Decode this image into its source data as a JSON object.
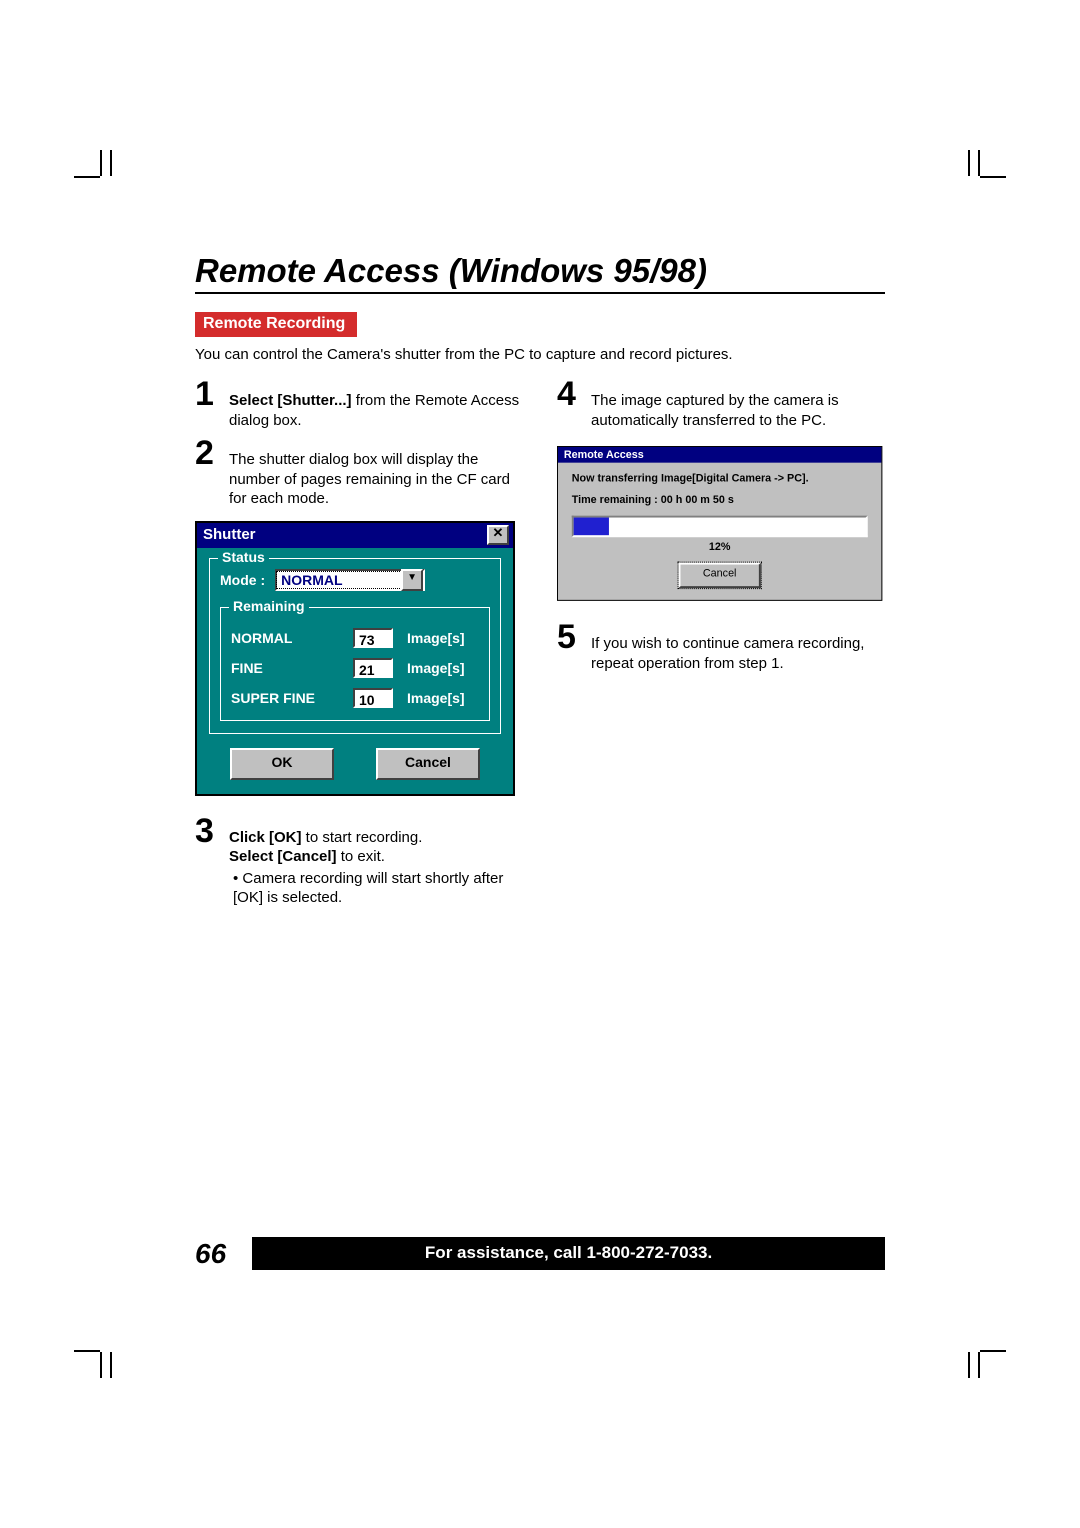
{
  "title": "Remote Access (Windows 95/98)",
  "section": "Remote Recording",
  "intro": "You can control the Camera's shutter from the PC to capture and record pictures.",
  "steps": {
    "s1": {
      "num": "1",
      "bold": "Select [Shutter...]",
      "rest": "  from the Remote Access dialog box."
    },
    "s2": {
      "num": "2",
      "text": "The shutter dialog box will display the number of pages remaining in the CF card for each mode."
    },
    "s3": {
      "num": "3",
      "bold1": "Click [OK]",
      "rest1": " to start recording.",
      "bold2": "Select [Cancel]",
      "rest2": " to exit.",
      "bullet": "• Camera recording will start shortly after [OK] is selected."
    },
    "s4": {
      "num": "4",
      "text": "The image captured by the camera is automatically transferred to the PC."
    },
    "s5": {
      "num": "5",
      "text": "If you wish to continue camera recording, repeat operation from step 1."
    }
  },
  "shutter": {
    "title": "Shutter",
    "status_legend": "Status",
    "mode_label": "Mode :",
    "mode_value": "NORMAL",
    "remaining_legend": "Remaining",
    "rows": [
      {
        "label": "NORMAL",
        "value": "73",
        "unit": "Image[s]"
      },
      {
        "label": "FINE",
        "value": "21",
        "unit": "Image[s]"
      },
      {
        "label": "SUPER FINE",
        "value": "10",
        "unit": "Image[s]"
      }
    ],
    "ok": "OK",
    "cancel": "Cancel"
  },
  "remote_access": {
    "title": "Remote Access",
    "line1": "Now transferring Image[Digital Camera -> PC].",
    "line2": "Time remaining : 00 h 00 m 50 s",
    "percent": "12%",
    "cancel": "Cancel"
  },
  "footer": {
    "page": "66",
    "assist": "For assistance, call 1-800-272-7033."
  }
}
